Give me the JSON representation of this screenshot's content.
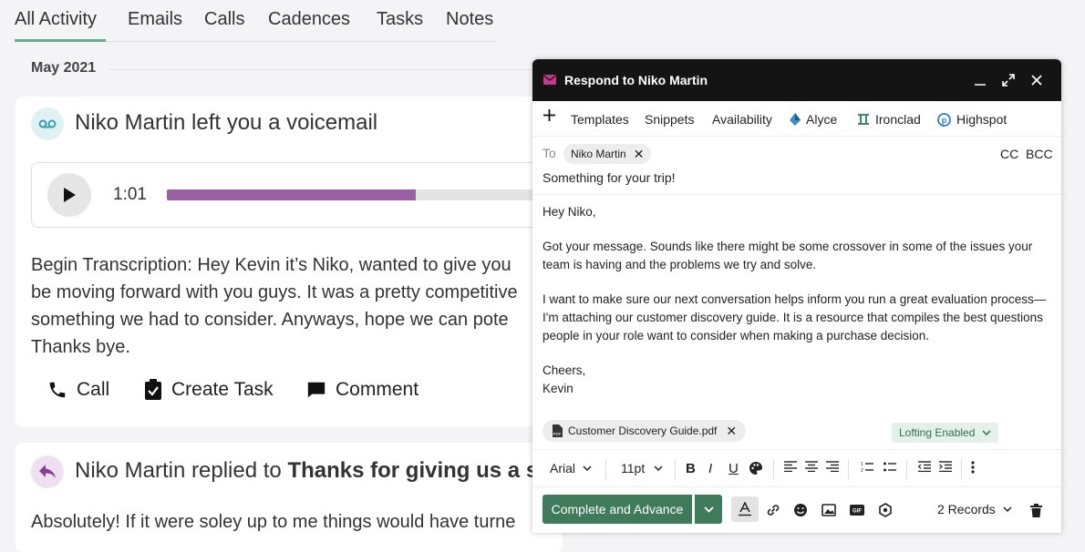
{
  "tabs": [
    "All Activity",
    "Emails",
    "Calls",
    "Cadences",
    "Tasks",
    "Notes"
  ],
  "active_tab": "All Activity",
  "month_label": "May 2021",
  "voicemail": {
    "title": "Niko Martin left you a voicemail",
    "duration": "1:01",
    "progress_fraction": 0.65,
    "transcript_lines": [
      "Begin Transcription: Hey Kevin it’s Niko, wanted to give you",
      "be moving forward with you guys. It was a pretty competitive",
      "something we had to consider. Anyways, hope we can pote",
      "Thanks bye."
    ],
    "actions": {
      "call": "Call",
      "create_task": "Create Task",
      "comment": "Comment"
    }
  },
  "reply": {
    "prefix": "Niko Martin replied to ",
    "subject_bold": "Thanks for giving us a sh",
    "preview": "Absolutely! If it were soley up to me things would have turne"
  },
  "compose": {
    "title": "Respond to Niko Martin",
    "toolbar": [
      "Templates",
      "Snippets",
      "Availability",
      "Alyce",
      "Ironclad",
      "Highspot"
    ],
    "to_label": "To",
    "recipient": "Niko Martin",
    "cc": "CC",
    "bcc": "BCC",
    "subject": "Something for your trip!",
    "body": [
      "Hey Niko,",
      "Got your message. Sounds like there might be some crossover in some of the issues your team is having and the problems we try and solve.",
      "I want to make sure our next conversation helps inform you run a great evaluation process—I'm attaching our customer discovery guide. It is a resource that compiles the best questions people in your role want to consider when making a purchase decision.",
      "Cheers,\nKevin"
    ],
    "attachment": "Customer Discovery Guide.pdf",
    "lofting": "Lofting Enabled",
    "font": "Arial",
    "font_size": "11pt",
    "complete_label": "Complete and Advance",
    "records": "2 Records"
  },
  "colors": {
    "accent_green": "#3f7a5b",
    "progress_purple": "#9a5ea4",
    "tab_underline": "#6aab8e"
  }
}
